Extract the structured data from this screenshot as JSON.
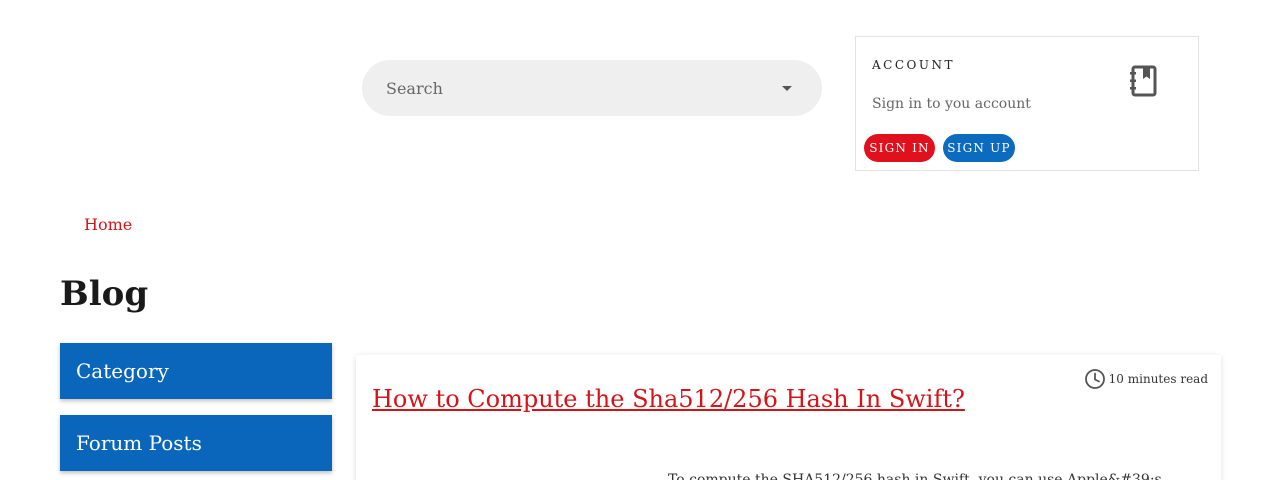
{
  "search": {
    "placeholder": "Search"
  },
  "account": {
    "title": "ACCOUNT",
    "subtitle": "Sign in to you account",
    "icon": "notebook-bookmark-icon",
    "sign_in_label": "SIGN IN",
    "sign_up_label": "SIGN UP",
    "colors": {
      "sign_in": "#e0101c",
      "sign_up": "#0a6bbf"
    }
  },
  "breadcrumb": {
    "home_label": "Home"
  },
  "page": {
    "title": "Blog"
  },
  "sidebar": {
    "items": [
      {
        "label": "Category"
      },
      {
        "label": "Forum Posts"
      }
    ],
    "color": "#0a66bb"
  },
  "post": {
    "title": "How to Compute the Sha512/256 Hash In Swift?",
    "read_time": "10 minutes read",
    "excerpt": "To compute the SHA512/256 hash in Swift, you can use Apple&#39;s"
  }
}
